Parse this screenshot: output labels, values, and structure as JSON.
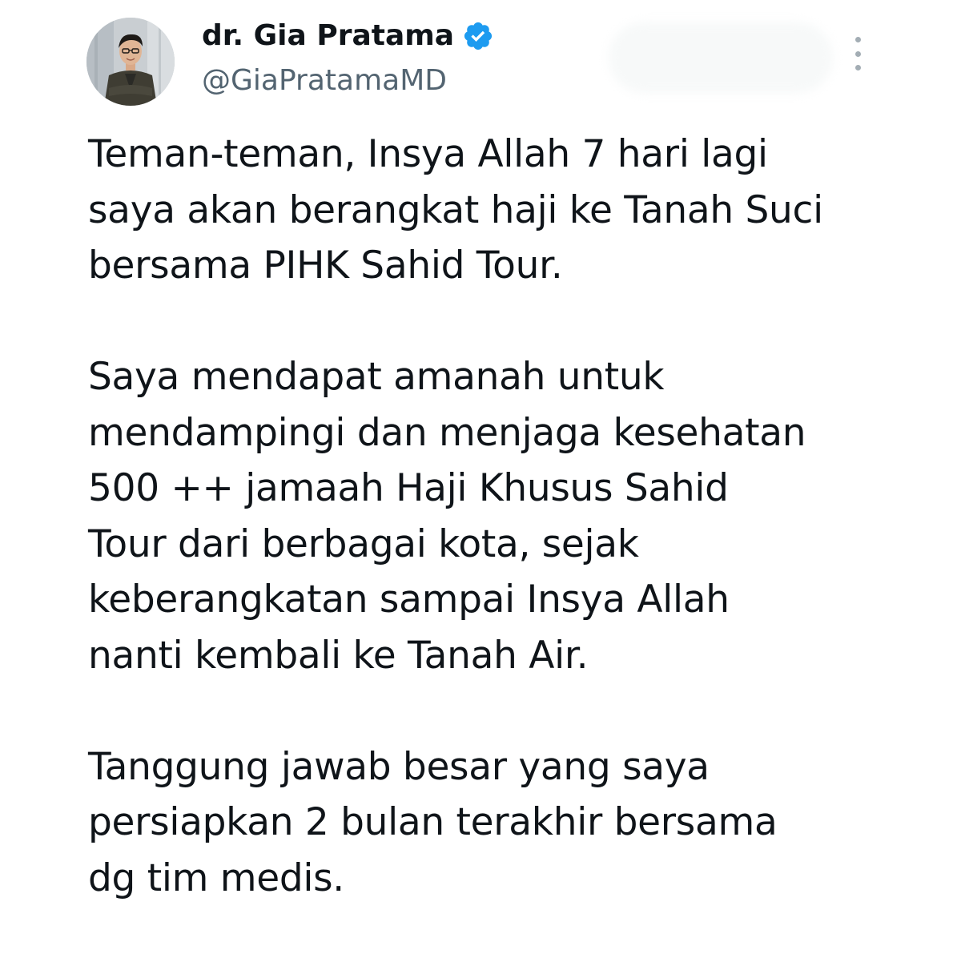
{
  "author": {
    "display_name": "dr. Gia Pratama",
    "handle": "@GiaPratamaMD",
    "verified": true,
    "verified_color": "#1d9bf0"
  },
  "actions": {
    "more_icon": "more-vertical-icon"
  },
  "tweet": {
    "paragraphs": [
      {
        "lines": [
          "Teman-teman, Insya Allah 7 hari lagi",
          "saya akan berangkat haji ke Tanah Suci",
          "bersama PIHK Sahid Tour."
        ]
      },
      {
        "lines": [
          "Saya mendapat amanah untuk",
          "mendampingi dan menjaga kesehatan",
          "500 ++ jamaah Haji Khusus Sahid",
          "Tour dari berbagai kota, sejak",
          "keberangkatan sampai Insya Allah",
          "nanti kembali ke Tanah Air."
        ]
      },
      {
        "lines": [
          "Tanggung jawab besar yang saya",
          "persiapkan 2 bulan terakhir bersama",
          "dg tim medis."
        ]
      }
    ]
  }
}
